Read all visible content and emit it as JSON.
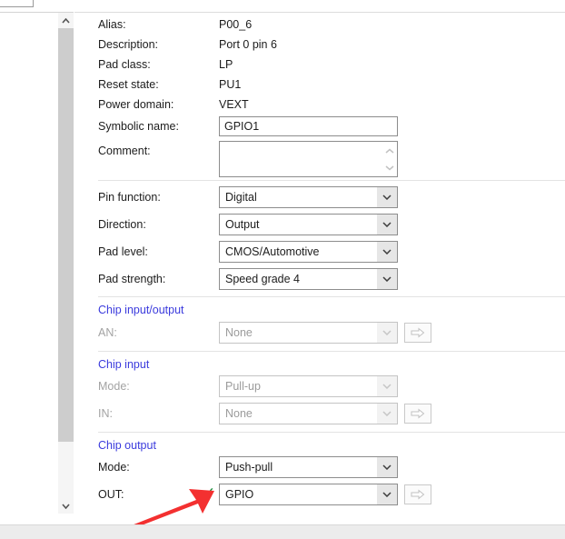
{
  "scrollbar": {
    "up_icon": "chevron-up-icon",
    "down_icon": "chevron-down-icon"
  },
  "info_rows": [
    {
      "label": "Alias:",
      "value": "P00_6"
    },
    {
      "label": "Description:",
      "value": "Port 0 pin 6"
    },
    {
      "label": "Pad class:",
      "value": "LP"
    },
    {
      "label": "Reset state:",
      "value": "PU1"
    },
    {
      "label": "Power domain:",
      "value": "VEXT"
    }
  ],
  "symbolic_name": {
    "label": "Symbolic name:",
    "value": "GPIO1",
    "placeholder": ""
  },
  "comment": {
    "label": "Comment:",
    "value": "",
    "placeholder": "",
    "spinner_up": "▲",
    "spinner_down": "▼"
  },
  "settings": [
    {
      "label": "Pin function:",
      "value": "Digital"
    },
    {
      "label": "Direction:",
      "value": "Output"
    },
    {
      "label": "Pad level:",
      "value": "CMOS/Automotive"
    },
    {
      "label": "Pad strength:",
      "value": "Speed grade 4"
    }
  ],
  "chip_io": {
    "heading": "Chip input/output",
    "rows": [
      {
        "label": "AN:",
        "value": "None",
        "enabled": false,
        "has_go": true
      }
    ]
  },
  "chip_in": {
    "heading": "Chip input",
    "rows": [
      {
        "label": "Mode:",
        "value": "Pull-up",
        "enabled": false,
        "has_go": false
      },
      {
        "label": "IN:",
        "value": "None",
        "enabled": false,
        "has_go": true
      }
    ]
  },
  "chip_out": {
    "heading": "Chip output",
    "rows": [
      {
        "label": "Mode:",
        "value": "Push-pull",
        "enabled": true,
        "has_go": false
      },
      {
        "label": "OUT:",
        "value": "GPIO",
        "enabled": true,
        "has_go": true
      }
    ]
  },
  "annotations": {
    "check_glyph": "✓",
    "check_color": "#1a8f3c",
    "arrow_color": "#f33030"
  },
  "colors": {
    "section_heading": "#3b3bdd",
    "disabled_text": "#a3a3a3",
    "text": "#1c1c1c"
  }
}
